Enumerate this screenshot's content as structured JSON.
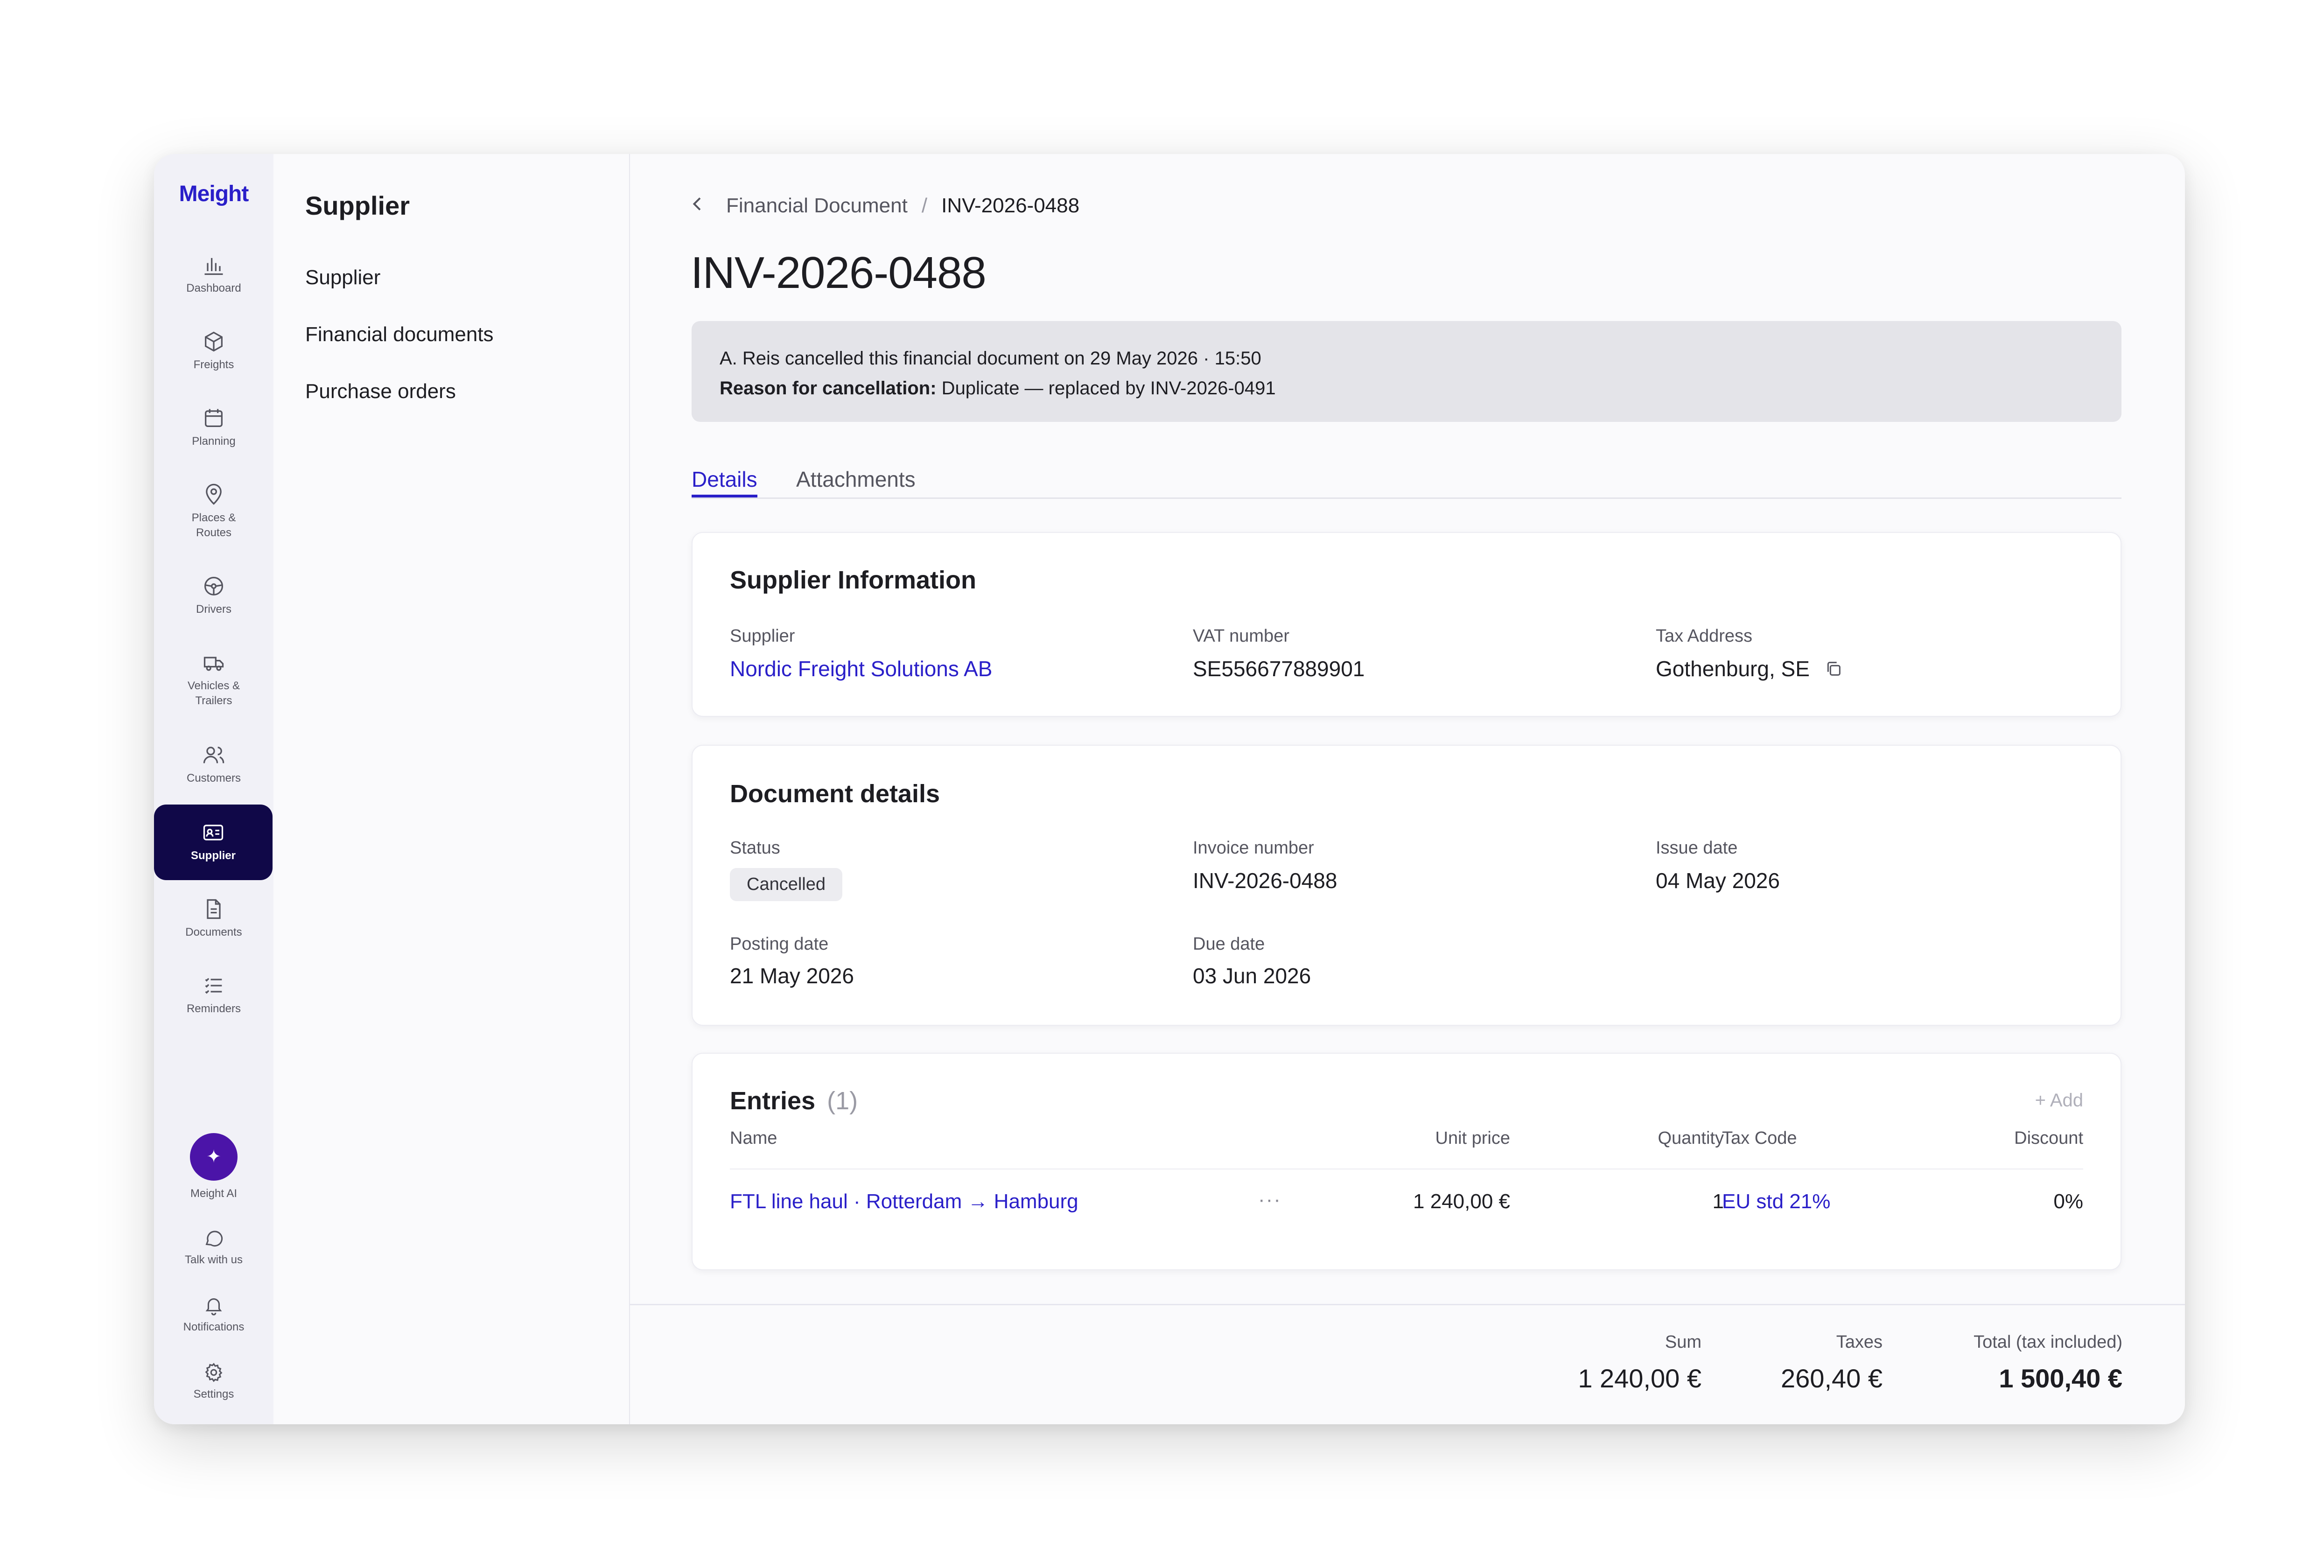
{
  "app": {
    "brand": "Meight"
  },
  "rail": {
    "items": [
      {
        "label": "Dashboard",
        "icon": "bar-chart-icon"
      },
      {
        "label": "Freights",
        "icon": "box-icon"
      },
      {
        "label": "Planning",
        "icon": "calendar-icon"
      },
      {
        "label": "Places & Routes",
        "icon": "map-pin-icon"
      },
      {
        "label": "Drivers",
        "icon": "steering-wheel-icon"
      },
      {
        "label": "Vehicles & Trailers",
        "icon": "truck-icon"
      },
      {
        "label": "Customers",
        "icon": "users-icon"
      },
      {
        "label": "Supplier",
        "icon": "id-card-icon"
      },
      {
        "label": "Documents",
        "icon": "document-icon"
      },
      {
        "label": "Reminders",
        "icon": "checklist-icon"
      }
    ],
    "bottom": [
      {
        "label": "Meight AI",
        "icon": "sparkle-icon"
      },
      {
        "label": "Talk with us",
        "icon": "chat-bubble-icon"
      },
      {
        "label": "Notifications",
        "icon": "bell-icon"
      },
      {
        "label": "Settings",
        "icon": "gear-icon"
      }
    ],
    "active": "Supplier"
  },
  "subnav": {
    "title": "Supplier",
    "items": [
      "Supplier",
      "Financial documents",
      "Purchase orders"
    ]
  },
  "breadcrumb": {
    "parent": "Financial Document",
    "separator": "/",
    "current": "INV-2026-0488"
  },
  "page": {
    "title": "INV-2026-0488"
  },
  "banner": {
    "line1": "A. Reis cancelled this financial document on 29 May 2026 · 15:50",
    "reason_label": "Reason for cancellation:",
    "reason_text": " Duplicate — replaced by INV-2026-0491"
  },
  "tabs": [
    {
      "label": "Details",
      "active": true
    },
    {
      "label": "Attachments",
      "active": false
    }
  ],
  "supplier_info": {
    "title": "Supplier Information",
    "supplier_label": "Supplier",
    "supplier_value": "Nordic Freight Solutions AB",
    "vat_label": "VAT number",
    "vat_value": "SE556677889901",
    "tax_label": "Tax Address",
    "tax_value": "Gothenburg, SE"
  },
  "document_details": {
    "title": "Document details",
    "status_label": "Status",
    "status_value": "Cancelled",
    "invoice_label": "Invoice number",
    "invoice_value": "INV-2026-0488",
    "issue_label": "Issue date",
    "issue_value": "04 May 2026",
    "posting_label": "Posting date",
    "posting_value": "21 May 2026",
    "due_label": "Due date",
    "due_value": "03 Jun 2026"
  },
  "entries": {
    "title": "Entries",
    "count": "(1)",
    "add_label": "+ Add",
    "columns": [
      "Name",
      "Unit price",
      "Quantity",
      "Tax Code",
      "Discount"
    ],
    "rows": [
      {
        "name": "FTL line haul · Rotterdam → Hamburg",
        "more": "···",
        "unit_price": "1 240,00 €",
        "quantity": "1",
        "tax_code": "EU std 21%",
        "discount": "0%"
      }
    ]
  },
  "totals": {
    "sum_label": "Sum",
    "sum_value": "1 240,00 €",
    "taxes_label": "Taxes",
    "taxes_value": "260,40 €",
    "total_label": "Total (tax included)",
    "total_value": "1 500,40 €"
  },
  "colors": {
    "accent": "#2a1fc9",
    "rail_active": "#100848",
    "ai": "#4b14a8",
    "banner": "#e4e4e9"
  }
}
